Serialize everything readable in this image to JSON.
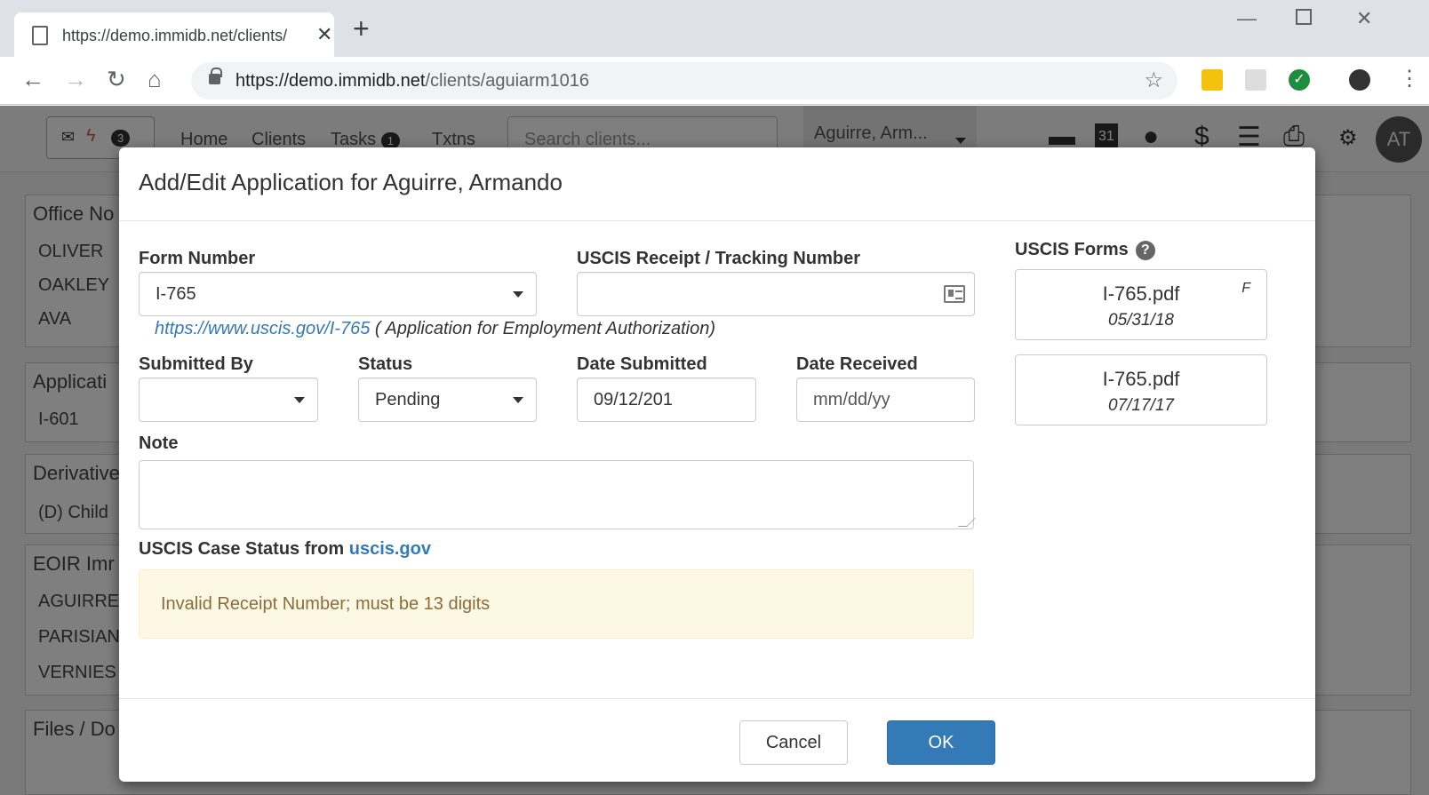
{
  "browser": {
    "tab_title": "https://demo.immidb.net/clients/",
    "url_host": "https://demo.immidb.net",
    "url_path": "/clients/aguiarm1016"
  },
  "appnav": {
    "msg_count": "3",
    "links": [
      "Home",
      "Clients",
      "Tasks",
      "Txtns"
    ],
    "tasks_count": "1",
    "search_placeholder": "Search clients...",
    "client_selector": "Aguirre, Arm...",
    "calendar_day": "31",
    "avatar": "AT"
  },
  "background": {
    "office_notes_header": "Office No",
    "office_rows": [
      "OLIVER",
      "OAKLEY",
      "AVA"
    ],
    "applications_header": "Applicati",
    "applications_rows": [
      "I-601"
    ],
    "derivatives_header": "Derivative",
    "derivatives_rows": [
      "(D) Child"
    ],
    "eoir_header": "EOIR Imr",
    "eoir_rows": [
      "AGUIRRE",
      "PARISIAN",
      "VERNIES"
    ],
    "files_header": "Files / Do"
  },
  "modal": {
    "title": "Add/Edit Application for Aguirre, Armando",
    "form_number_label": "Form Number",
    "form_number_value": "I-765",
    "form_link": "https://www.uscis.gov/I-765",
    "form_description": "( Application for Employment Authorization)",
    "receipt_label": "USCIS Receipt / Tracking Number",
    "receipt_value": "",
    "submitted_by_label": "Submitted By",
    "submitted_by_value": "",
    "status_label": "Status",
    "status_value": "Pending",
    "date_submitted_label": "Date Submitted",
    "date_submitted_value": "09/12/201",
    "date_received_label": "Date Received",
    "date_received_placeholder": "mm/dd/yy",
    "note_label": "Note",
    "note_value": "",
    "case_status_label": "USCIS Case Status from ",
    "case_status_link": "uscis.gov",
    "case_status_message": "Invalid Receipt Number; must be 13 digits",
    "uscis_forms_label": "USCIS Forms",
    "uscis_forms": [
      {
        "name": "I-765.pdf",
        "date": "05/31/18",
        "flag": "F"
      },
      {
        "name": "I-765.pdf",
        "date": "07/17/17",
        "flag": ""
      }
    ],
    "cancel_label": "Cancel",
    "ok_label": "OK"
  }
}
